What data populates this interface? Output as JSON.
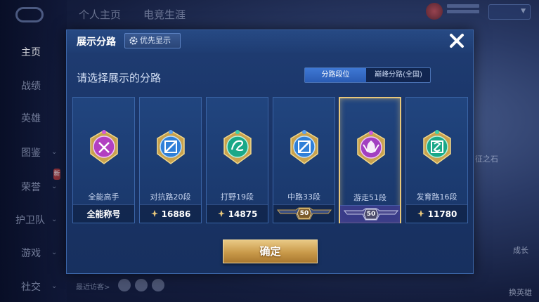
{
  "background": {
    "top_tabs": [
      "个人主页",
      "电竞生涯"
    ],
    "sidebar": [
      {
        "label": "主页",
        "active": true,
        "arrow": false
      },
      {
        "label": "战绩",
        "active": false,
        "arrow": false
      },
      {
        "label": "英雄",
        "active": false,
        "arrow": false
      },
      {
        "label": "图鉴",
        "active": false,
        "arrow": true
      },
      {
        "label": "荣誉",
        "active": false,
        "arrow": true
      },
      {
        "label": "护卫队",
        "active": false,
        "arrow": true
      },
      {
        "label": "游戏",
        "active": false,
        "arrow": true
      },
      {
        "label": "社交",
        "active": false,
        "arrow": true
      }
    ],
    "sidebar_badge": "新",
    "right_tags": [
      "征之石",
      "成长",
      "换英雄"
    ],
    "recent_visitors": "最近访客>"
  },
  "modal": {
    "title": "展示分路",
    "priority_button": "优先显示",
    "subtitle": "请选择展示的分路",
    "segment_tabs": [
      {
        "label": "分路段位",
        "active": true
      },
      {
        "label": "巅峰分路(全国)",
        "active": false
      }
    ],
    "cards": [
      {
        "label": "全能高手",
        "footer": "全能称号",
        "footer_type": "text",
        "emblem_color": "#b23fc1",
        "selected": false
      },
      {
        "label": "对抗路20段",
        "footer": "16886",
        "footer_type": "score",
        "emblem_color": "#2f7fd8",
        "selected": false
      },
      {
        "label": "打野19段",
        "footer": "14875",
        "footer_type": "score",
        "emblem_color": "#1aa888",
        "selected": false
      },
      {
        "label": "中路33段",
        "footer": "50",
        "footer_type": "rank",
        "emblem_color": "#2f7fd8",
        "selected": false
      },
      {
        "label": "游走51段",
        "footer": "50",
        "footer_type": "rank",
        "emblem_color": "#a23fc1",
        "selected": true
      },
      {
        "label": "发育路16段",
        "footer": "11780",
        "footer_type": "score",
        "emblem_color": "#1aa888",
        "selected": false
      }
    ],
    "confirm_button": "确定"
  },
  "colors": {
    "modal_bg": "#1c3c72",
    "accent_blue": "#2a5cb4",
    "gold": "#e8c77a"
  }
}
